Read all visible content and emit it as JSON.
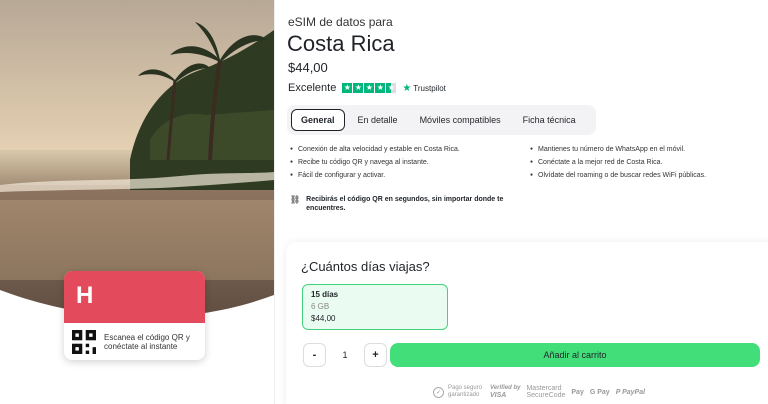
{
  "hero": {
    "qr_card": {
      "brand_logo": "H",
      "scan_text": "Escanea el código QR y conéctate al instante"
    }
  },
  "product": {
    "subtitle": "eSIM de datos para",
    "title": "Costa Rica",
    "price": "$44,00",
    "rating_label": "Excelente",
    "trustpilot": "Trustpilot"
  },
  "tabs": [
    {
      "label": "General",
      "active": true
    },
    {
      "label": "En detalle",
      "active": false
    },
    {
      "label": "Móviles compatibles",
      "active": false
    },
    {
      "label": "Ficha técnica",
      "active": false
    }
  ],
  "features": {
    "col1": [
      "Conexión de alta velocidad y estable en Costa Rica.",
      "Recibe tu código QR y navega al instante.",
      "Fácil de configurar y activar."
    ],
    "col2": [
      "Mantienes tu número de WhatsApp en el móvil.",
      "Conéctate a la mejor red de Costa Rica.",
      "Olvídate del roaming o de buscar redes WiFi públicas."
    ]
  },
  "qr_note": "Recibirás el código QR en segundos, sin importar donde te encuentres.",
  "purchase": {
    "question": "¿Cuántos días viajas?",
    "plan": {
      "days": "15 días",
      "data": "6 GB",
      "price": "$44,00"
    },
    "quantity": "1",
    "minus": "-",
    "plus": "+",
    "add_to_cart": "Añadir al carrito",
    "payments": {
      "secure": "Pago seguro garantizado",
      "verified_top": "Verified by",
      "verified_bottom": "VISA",
      "mc_top": "Mastercard",
      "mc_bottom": "SecureCode",
      "apple": "Pay",
      "google": "G Pay",
      "paypal": "PayPal"
    }
  },
  "colors": {
    "accent_green": "#41de7a",
    "brand_red": "#e34b5c",
    "trustpilot_green": "#00b67a"
  }
}
